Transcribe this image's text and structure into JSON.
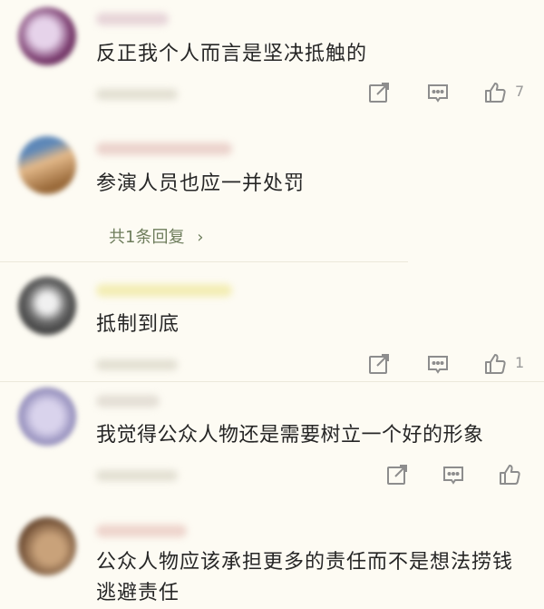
{
  "comments": [
    {
      "text": "反正我个人而言是坚决抵触的",
      "likes": "7",
      "avatar_colors": [
        "#7a3b6e",
        "#d7b8d8"
      ],
      "name_color": "#e0c8d0"
    },
    {
      "text": "参演人员也应一并处罚",
      "replies_label": "共1条回复",
      "replies_chevron": "›",
      "avatar_colors": [
        "#9a6a3a",
        "#e7c18a"
      ],
      "name_color": "#e6c6c0"
    },
    {
      "text": "抵制到底",
      "likes": "1",
      "avatar_colors": [
        "#3a3a3a",
        "#c8c8c8"
      ],
      "name_color": "#f0e9a0"
    },
    {
      "text": "我觉得公众人物还是需要树立一个好的形象",
      "likes": "",
      "avatar_colors": [
        "#8c86b6",
        "#d9d3ec"
      ],
      "name_color": "#dcd6cc"
    },
    {
      "text": "公众人物应该承担更多的责任而不是想法捞钱逃避责任",
      "avatar_colors": [
        "#5a3a24",
        "#c9a27a"
      ],
      "name_color": "#e9c8c0"
    }
  ],
  "icons": {
    "share": "share-icon",
    "comment": "comment-icon",
    "like": "thumbs-up-icon"
  },
  "colors": {
    "background": "#fdfbf3",
    "icon": "#8d8d8d",
    "replies_link": "#6e7d5c"
  }
}
